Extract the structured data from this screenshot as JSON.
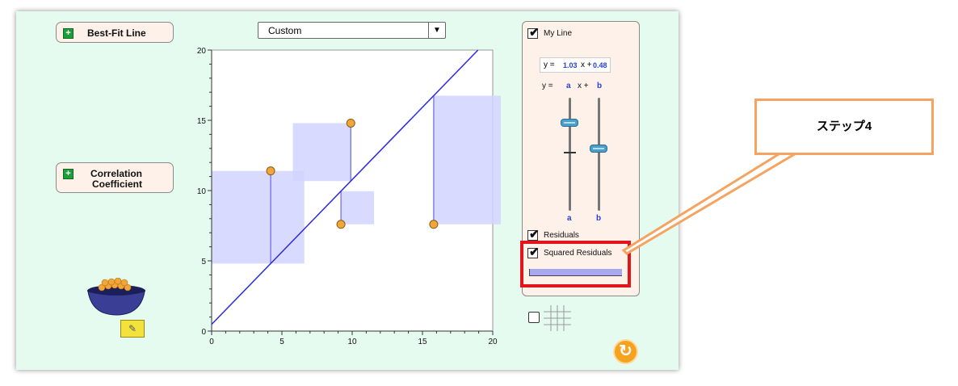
{
  "buttons": {
    "best_fit": "Best-Fit Line",
    "corr_line1": "Correlation",
    "corr_line2": "Coefficient"
  },
  "dataset_select": {
    "value": "Custom"
  },
  "colors": {
    "line": "#2a2ae0",
    "square_fill": "#d2d4ff",
    "point": "#f0a63a",
    "panel": "#fdf1ea",
    "background": "#e6fbef"
  },
  "chart_data": {
    "type": "scatter",
    "xlim": [
      0,
      20
    ],
    "ylim": [
      0,
      20
    ],
    "x_ticks": [
      0,
      5,
      10,
      15,
      20
    ],
    "y_ticks": [
      0,
      5,
      10,
      15,
      20
    ],
    "points": [
      {
        "x": 4.2,
        "y": 11.4
      },
      {
        "x": 9.2,
        "y": 7.6
      },
      {
        "x": 9.9,
        "y": 14.8
      },
      {
        "x": 15.8,
        "y": 7.6
      }
    ],
    "line": {
      "slope": 1.03,
      "intercept": 0.48
    },
    "show_residuals": true,
    "show_squared_residuals": true
  },
  "panel": {
    "my_line_label": "My Line",
    "eq_y": "y =",
    "eq_a": "1.03",
    "eq_x": "x +",
    "eq_b": "0.48",
    "form_y": "y =",
    "form_a": "a",
    "form_x": "x +",
    "form_b": "b",
    "slider_a_label": "a",
    "slider_b_label": "b",
    "slider_a_level": 0.78,
    "slider_b_level": 0.55,
    "residuals_label": "Residuals",
    "squared_residuals_label": "Squared Residuals",
    "my_line_checked": true,
    "residuals_checked": true,
    "squared_checked": true,
    "grid_checked": false
  },
  "callout": {
    "text": "ステップ4"
  }
}
